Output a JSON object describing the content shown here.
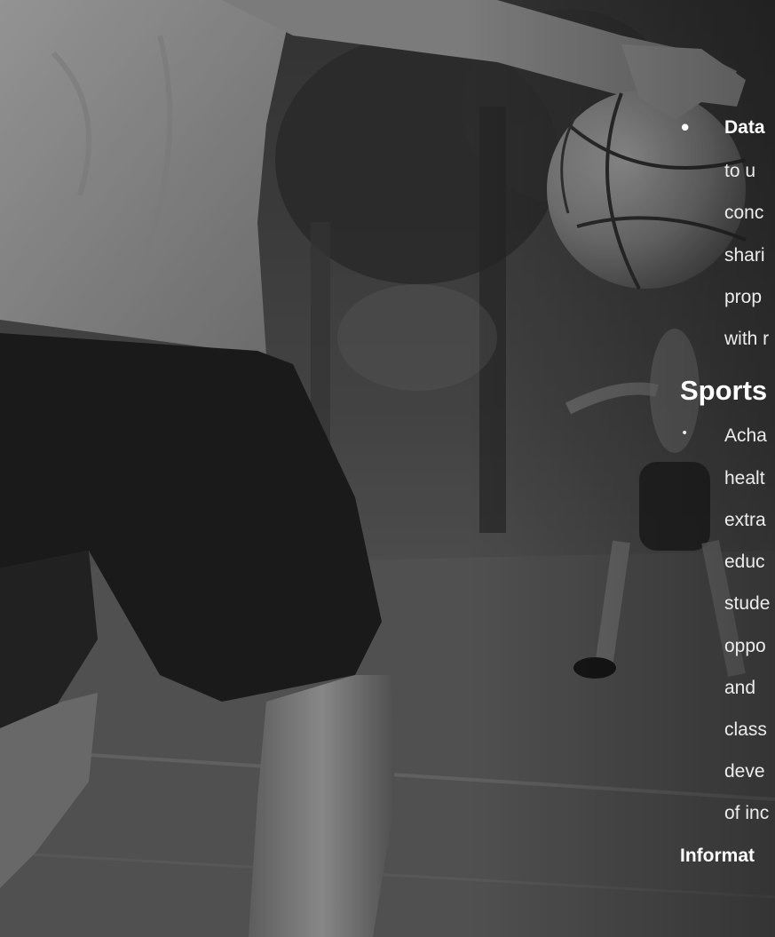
{
  "bullets": {
    "dot": "•",
    "small_dot": "•"
  },
  "section_one": {
    "lead": "Data",
    "lines": [
      "to  u",
      "conc",
      "shari",
      "prop",
      "with r"
    ]
  },
  "section_two": {
    "heading": "Sports",
    "lines": [
      "Acha",
      "healt",
      "extra",
      "educ",
      "stude",
      "oppo",
      "and",
      "class",
      "deve",
      "of inc"
    ]
  },
  "footer": {
    "label": "Informat"
  }
}
